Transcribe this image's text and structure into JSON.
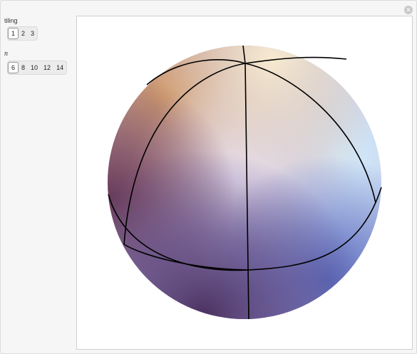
{
  "controls": {
    "tiling": {
      "label": "tiling",
      "options": [
        "1",
        "2",
        "3"
      ],
      "selected": "1"
    },
    "n": {
      "label": "n",
      "options": [
        "6",
        "8",
        "10",
        "12",
        "14"
      ],
      "selected": "6"
    }
  },
  "plot": {
    "type": "3D sphere with tiling edges",
    "surface_colors": {
      "top_left": "#c98a5a",
      "top": "#f5dcb0",
      "right": "#cfe8f8",
      "center": "#e8dff0",
      "bottom_left": "#5a3a6a",
      "bottom_right": "#6a78c0"
    },
    "edge_color": "#000000"
  }
}
